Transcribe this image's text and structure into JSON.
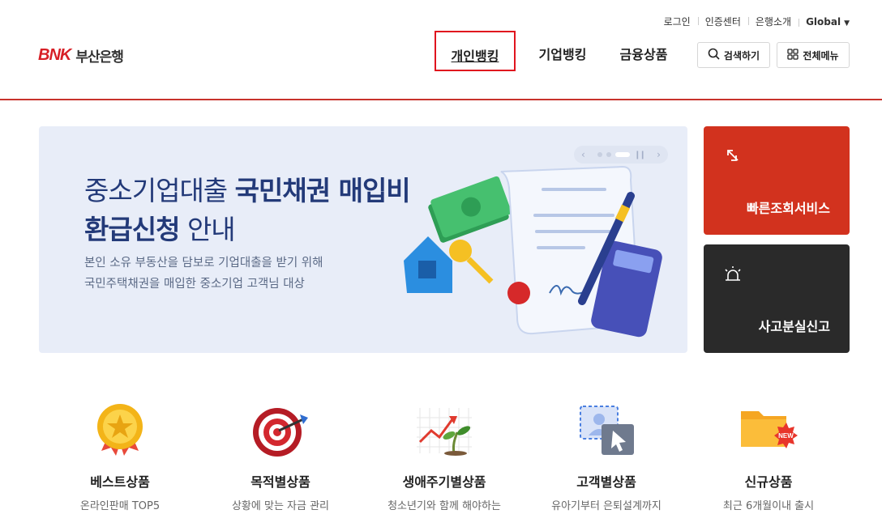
{
  "util_nav": {
    "login": "로그인",
    "cert_center": "인증센터",
    "about": "은행소개",
    "global": "Global"
  },
  "logo": {
    "brand": "BNK",
    "name": "부산은행"
  },
  "gnb": {
    "personal": "개인뱅킹",
    "corporate": "기업뱅킹",
    "products": "금융상품"
  },
  "top_buttons": {
    "search": "검색하기",
    "all_menu": "전체메뉴"
  },
  "banner": {
    "title_line1_regular": "중소기업대출 ",
    "title_line1_bold": "국민채권 매입비",
    "title_line2_bold": "환급신청",
    "title_line2_regular": " 안내",
    "sub_line1": "본인 소유 부동산을 담보로 기업대출을 받기 위해",
    "sub_line2": "국민주택채권을 매입한 중소기업 고객님 대상"
  },
  "side_cards": {
    "quick_lookup": "빠른조회서비스",
    "loss_report": "사고분실신고"
  },
  "quick_menu": [
    {
      "title": "베스트상품",
      "sub": "온라인판매 TOP5"
    },
    {
      "title": "목적별상품",
      "sub": "상황에 맞는 자금 관리"
    },
    {
      "title": "생애주기별상품",
      "sub": "청소년기와 함께 해야하는"
    },
    {
      "title": "고객별상품",
      "sub": "유아기부터 은퇴설계까지"
    },
    {
      "title": "신규상품",
      "sub": "최근 6개월이내 출시"
    }
  ],
  "badge_new": "NEW",
  "colors": {
    "brand_red": "#d71f26",
    "card_red": "#d2321e",
    "card_dark": "#2a2a2a",
    "banner_bg": "#e8edf8",
    "title_navy": "#233a79"
  }
}
